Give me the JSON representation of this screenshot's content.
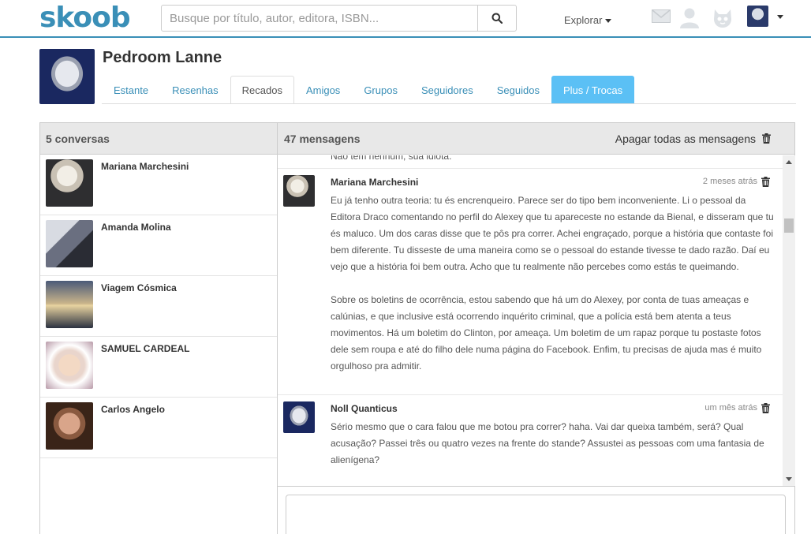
{
  "header": {
    "logo": "skoob",
    "search_placeholder": "Busque por título, autor, editora, ISBN...",
    "explorar_label": "Explorar",
    "brand_color": "#3a8fb7",
    "icons": [
      "search-icon",
      "mail-icon",
      "user-icon",
      "cat-icon",
      "avatar",
      "chevron-down-icon"
    ]
  },
  "profile": {
    "name": "Pedroom Lanne",
    "tabs": [
      {
        "label": "Estante"
      },
      {
        "label": "Resenhas"
      },
      {
        "label": "Recados",
        "active": true
      },
      {
        "label": "Amigos"
      },
      {
        "label": "Grupos"
      },
      {
        "label": "Seguidores"
      },
      {
        "label": "Seguidos"
      },
      {
        "label": "Plus / Trocas"
      }
    ]
  },
  "conversations": {
    "title": "5 conversas",
    "items": [
      {
        "name": "Mariana Marchesini"
      },
      {
        "name": "Amanda Molina"
      },
      {
        "name": "Viagem Cósmica"
      },
      {
        "name": "SAMUEL CARDEAL"
      },
      {
        "name": "Carlos Angelo"
      }
    ]
  },
  "messages": {
    "title": "47 mensagens",
    "delete_all_label": "Apagar todas as mensagens",
    "cut_text": "Não tem nenhum, sua idiota.",
    "items": [
      {
        "author": "Mariana Marchesini",
        "time": "2 meses atrás",
        "body": "Eu já tenho outra teoria: tu és encrenqueiro. Parece ser do tipo bem inconveniente. Li o pessoal da Editora Draco comentando no perfil do Alexey que tu apareceste no estande da Bienal, e disseram que tu és maluco. Um dos caras disse que te pôs pra correr. Achei engraçado, porque a história que contaste foi bem diferente. Tu disseste de uma maneira como se o pessoal do estande tivesse te dado razão. Daí eu vejo que a história foi bem outra. Acho que tu realmente não percebes como estás te queimando.\n\nSobre os boletins de ocorrência, estou sabendo que há um do Alexey, por conta de tuas ameaças e calúnias, e que inclusive está ocorrendo inquérito criminal, que a polícia está bem atenta a teus movimentos. Há um boletim do Clinton, por ameaça. Um boletim de um rapaz porque tu postaste fotos dele sem roupa e até do filho dele numa página do Facebook. Enfim, tu precisas de ajuda mas é muito orgulhoso pra admitir."
      },
      {
        "author": "Noll Quanticus",
        "time": "um mês atrás",
        "body": "Sério mesmo que o cara falou que me botou pra correr? haha. Vai dar queixa também, será? Qual acusação? Passei três ou quatro vezes na frente do stande? Assustei as pessoas com uma fantasia de alienígena?"
      }
    ]
  }
}
